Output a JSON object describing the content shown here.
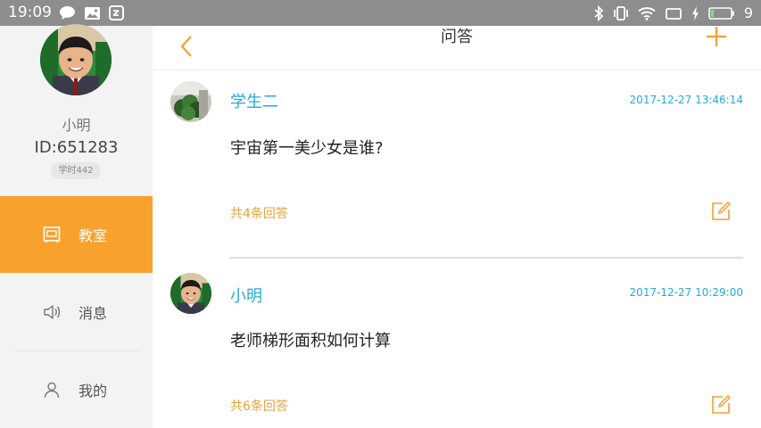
{
  "status_bar": {
    "time": "19:09",
    "battery_level": "9",
    "icons": [
      "chat-notification-icon",
      "image-notification-icon",
      "app-notification-icon",
      "bluetooth-icon",
      "vibrate-icon",
      "wifi-icon",
      "screen-icon",
      "charging-icon",
      "battery-icon"
    ]
  },
  "sidebar": {
    "user_name": "小明",
    "user_id": "ID:651283",
    "study_badge": "学时442",
    "nav": [
      {
        "label": "教室",
        "icon": "classroom-icon",
        "active": true
      },
      {
        "label": "消息",
        "icon": "speaker-icon",
        "active": false
      },
      {
        "label": "我的",
        "icon": "person-icon",
        "active": false
      }
    ]
  },
  "header": {
    "title": "问答"
  },
  "questions": [
    {
      "author": "学生二",
      "time": "2017-12-27 13:46:14",
      "text": "宇宙第一美少女是谁?",
      "answers": "共4条回答"
    },
    {
      "author": "小明",
      "time": "2017-12-27 10:29:00",
      "text": "老师梯形面积如何计算",
      "answers": "共6条回答"
    }
  ],
  "colors": {
    "accent_orange": "#f9a12d",
    "author_blue": "#27a9d8",
    "answer_count": "#e3a43d",
    "status_bar": "#8d8d8d"
  }
}
